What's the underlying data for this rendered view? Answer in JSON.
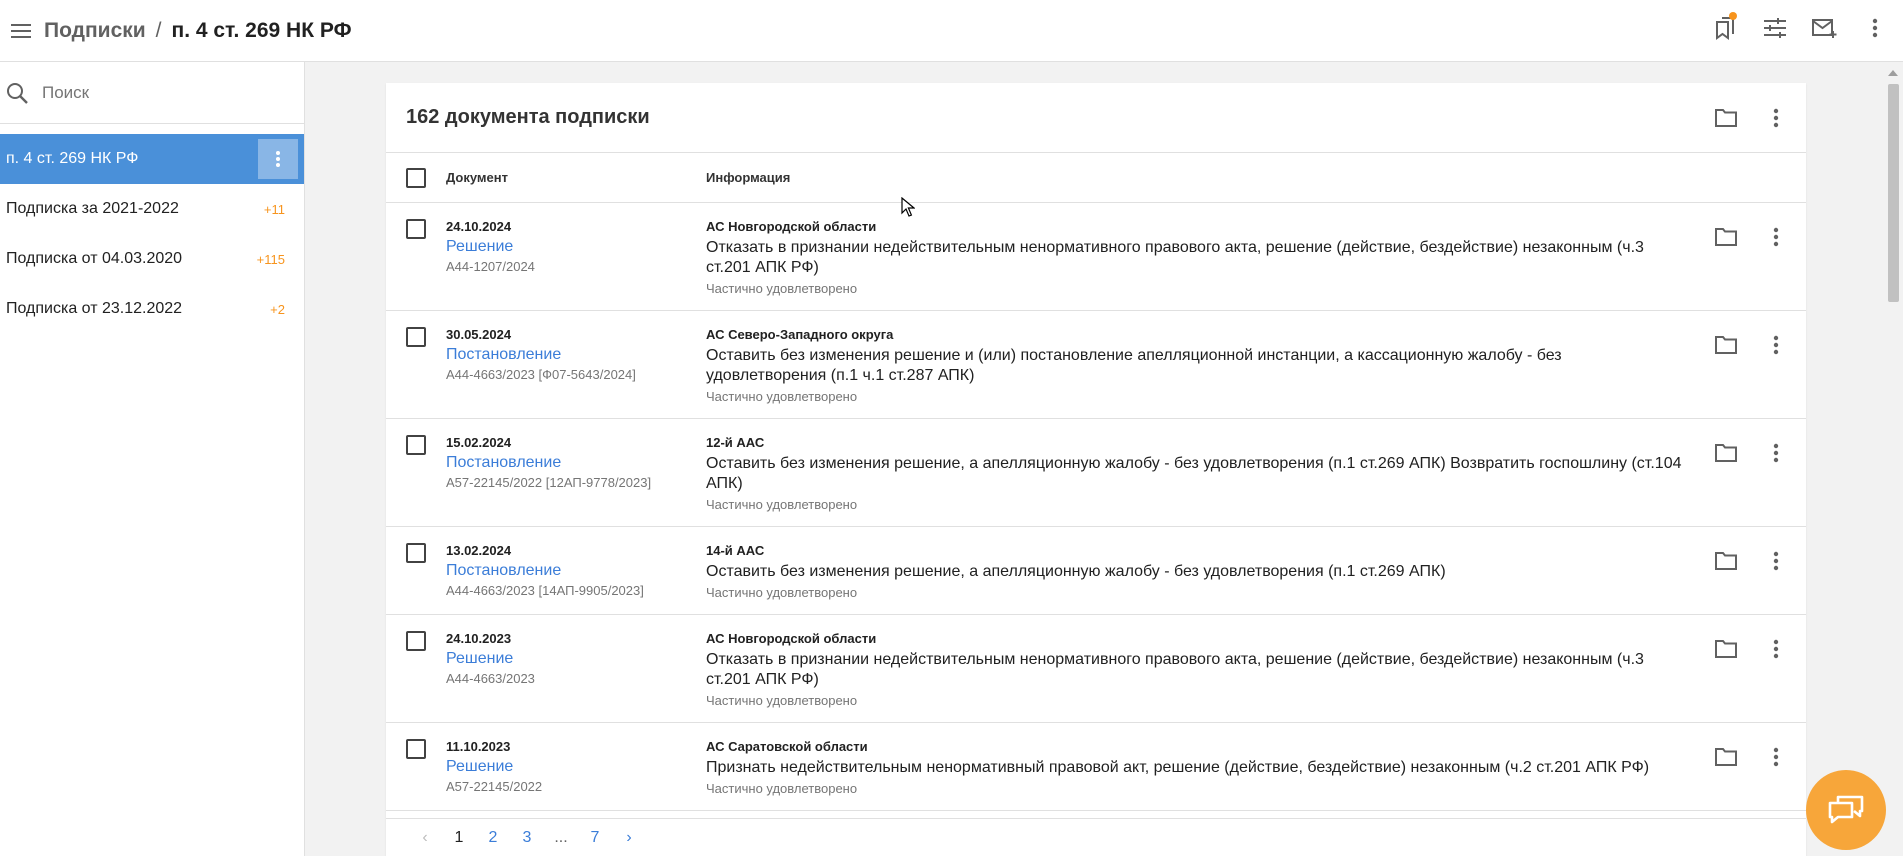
{
  "header": {
    "breadcrumb_root": "Подписки",
    "separator": "/",
    "current": "п. 4 ст. 269 НК РФ"
  },
  "sidebar": {
    "search_placeholder": "Поиск",
    "items": [
      {
        "label": "п. 4 ст. 269 НК РФ",
        "count": "",
        "active": true
      },
      {
        "label": "Подписка за 2021-2022",
        "count": "+11"
      },
      {
        "label": "Подписка от 04.03.2020",
        "count": "+115"
      },
      {
        "label": "Подписка от 23.12.2022",
        "count": "+2"
      }
    ]
  },
  "main": {
    "title": "162 документа подписки",
    "columns": {
      "document": "Документ",
      "info": "Информация"
    },
    "rows": [
      {
        "date": "24.10.2024",
        "type": "Решение",
        "case": "А44-1207/2024",
        "court": "АС Новгородской области",
        "decision": "Отказать в признании недействительным ненормативного правового акта, решение (действие, бездействие) незаконным (ч.3 ст.201 АПК РФ)",
        "status": "Частично удовлетворено"
      },
      {
        "date": "30.05.2024",
        "type": "Постановление",
        "case": "А44-4663/2023 [Ф07-5643/2024]",
        "court": "АС Северо-Западного округа",
        "decision": "Оставить без изменения решение и (или) постановление апелляционной инстанции, а кассационную жалобу - без удовлетворения (п.1 ч.1 ст.287 АПК)",
        "status": "Частично удовлетворено"
      },
      {
        "date": "15.02.2024",
        "type": "Постановление",
        "case": "А57-22145/2022 [12АП-9778/2023]",
        "court": "12-й ААС",
        "decision": "Оставить без изменения решение, а апелляционную жалобу - без удовлетворения (п.1 ст.269 АПК) Возвратить госпошлину (ст.104 АПК)",
        "status": "Частично удовлетворено"
      },
      {
        "date": "13.02.2024",
        "type": "Постановление",
        "case": "А44-4663/2023 [14АП-9905/2023]",
        "court": "14-й ААС",
        "decision": "Оставить без изменения решение, а апелляционную жалобу - без удовлетворения (п.1 ст.269 АПК)",
        "status": "Частично удовлетворено"
      },
      {
        "date": "24.10.2023",
        "type": "Решение",
        "case": "А44-4663/2023",
        "court": "АС Новгородской области",
        "decision": "Отказать в признании недействительным ненормативного правового акта, решение (действие, бездействие) незаконным (ч.3 ст.201 АПК РФ)",
        "status": "Частично удовлетворено"
      },
      {
        "date": "11.10.2023",
        "type": "Решение",
        "case": "А57-22145/2022",
        "court": "АС Саратовской области",
        "decision": "Признать недействительным ненормативный правовой акт, решение (действие, бездействие) незаконным (ч.2 ст.201 АПК РФ)",
        "status": "Частично удовлетворено"
      }
    ]
  },
  "pagination": {
    "prev": "‹",
    "pages": [
      "1",
      "2",
      "3"
    ],
    "ellipsis": "...",
    "last": "7",
    "next": "›",
    "current": "1"
  },
  "colors": {
    "accent": "#4a90d9",
    "link": "#3b7dd8",
    "badge": "#f7941d",
    "fab": "#f7a63a"
  },
  "icons": [
    "menu-icon",
    "bookmarks-icon",
    "filter-icon",
    "mail-add-icon",
    "more-vert-icon",
    "search-icon",
    "folder-icon",
    "chat-icon"
  ]
}
